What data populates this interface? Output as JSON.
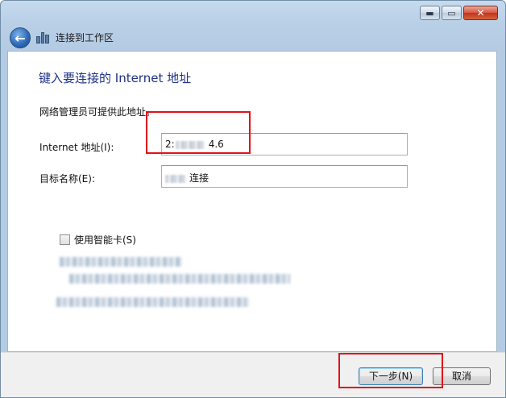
{
  "window": {
    "caption_buttons": {
      "minimize": "▬",
      "maximize": "▭",
      "close": "✕"
    }
  },
  "nav": {
    "title": "连接到工作区",
    "back_icon": "back-arrow-icon",
    "app_icon": "workspace-icon"
  },
  "page": {
    "heading": "键入要连接的 Internet 地址",
    "intro": "网络管理员可提供此地址。"
  },
  "form": {
    "internet_address": {
      "label": "Internet 地址(I):",
      "value_prefix": "2:",
      "value_suffix": "4.6"
    },
    "destination_name": {
      "label": "目标名称(E):",
      "value_suffix": "连接"
    }
  },
  "smartcard": {
    "label": "使用智能卡(S)",
    "checked": false
  },
  "buttons": {
    "next": "下一步(N)",
    "cancel": "取消"
  },
  "colors": {
    "heading": "#1e3287",
    "annotation": "#e0121b"
  }
}
